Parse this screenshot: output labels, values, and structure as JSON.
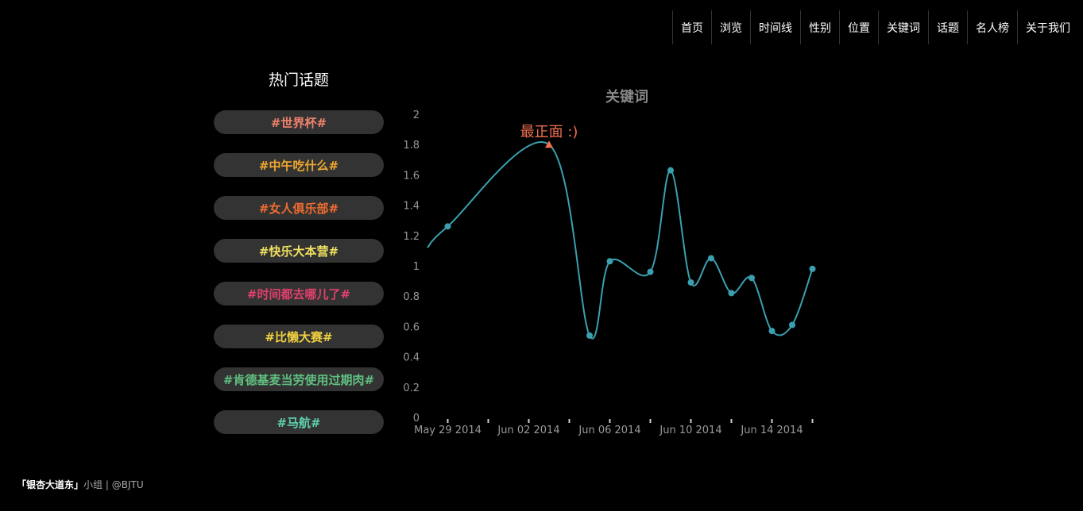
{
  "nav": {
    "items": [
      "首页",
      "浏览",
      "时间线",
      "性别",
      "位置",
      "关键词",
      "话题",
      "名人榜",
      "关于我们"
    ]
  },
  "topics": {
    "title": "热门话题",
    "items": [
      {
        "label": "#世界杯#",
        "color": "#f0826e"
      },
      {
        "label": "#中午吃什么#",
        "color": "#f0a830"
      },
      {
        "label": "#女人俱乐部#",
        "color": "#f06c30"
      },
      {
        "label": "#快乐大本营#",
        "color": "#f0e060"
      },
      {
        "label": "#时间都去哪儿了#",
        "color": "#e0406c"
      },
      {
        "label": "#比懒大赛#",
        "color": "#f0d040"
      },
      {
        "label": "#肯德基麦当劳使用过期肉#",
        "color": "#60c080"
      },
      {
        "label": "#马航#",
        "color": "#60d0b0"
      }
    ]
  },
  "chart_data": {
    "type": "line",
    "title": "关键词",
    "line_color": "#3aa0b0",
    "annotation": {
      "text": "最正面 :)",
      "x": "2014-06-03",
      "y": 1.8,
      "color": "#f07050"
    },
    "ylim": [
      0,
      2
    ],
    "yticks": [
      "0",
      "0.2",
      "0.4",
      "0.6",
      "0.8",
      "1",
      "1.2",
      "1.4",
      "1.6",
      "1.8",
      "2"
    ],
    "xlim": [
      "2014-05-28",
      "2014-06-17"
    ],
    "xtick_labels": [
      {
        "date": "2014-05-29",
        "label": "May 29 2014"
      },
      {
        "date": "2014-06-02",
        "label": "Jun 02 2014"
      },
      {
        "date": "2014-06-06",
        "label": "Jun 06 2014"
      },
      {
        "date": "2014-06-10",
        "label": "Jun 10 2014"
      },
      {
        "date": "2014-06-14",
        "label": "Jun 14 2014"
      }
    ],
    "series": [
      {
        "points": [
          {
            "x": "2014-05-28",
            "y": 1.12
          },
          {
            "x": "2014-05-29",
            "y": 1.26
          },
          {
            "x": "2014-06-03",
            "y": 1.8
          },
          {
            "x": "2014-06-05",
            "y": 0.54
          },
          {
            "x": "2014-06-06",
            "y": 1.03
          },
          {
            "x": "2014-06-08",
            "y": 0.96
          },
          {
            "x": "2014-06-09",
            "y": 1.63
          },
          {
            "x": "2014-06-10",
            "y": 0.89
          },
          {
            "x": "2014-06-11",
            "y": 1.05
          },
          {
            "x": "2014-06-12",
            "y": 0.82
          },
          {
            "x": "2014-06-13",
            "y": 0.92
          },
          {
            "x": "2014-06-14",
            "y": 0.57
          },
          {
            "x": "2014-06-15",
            "y": 0.61
          },
          {
            "x": "2014-06-16",
            "y": 0.98
          }
        ]
      }
    ]
  },
  "footer": {
    "brand": "「银杏大道东」",
    "group": "小组",
    "separator": "|",
    "org": "@BJTU"
  }
}
